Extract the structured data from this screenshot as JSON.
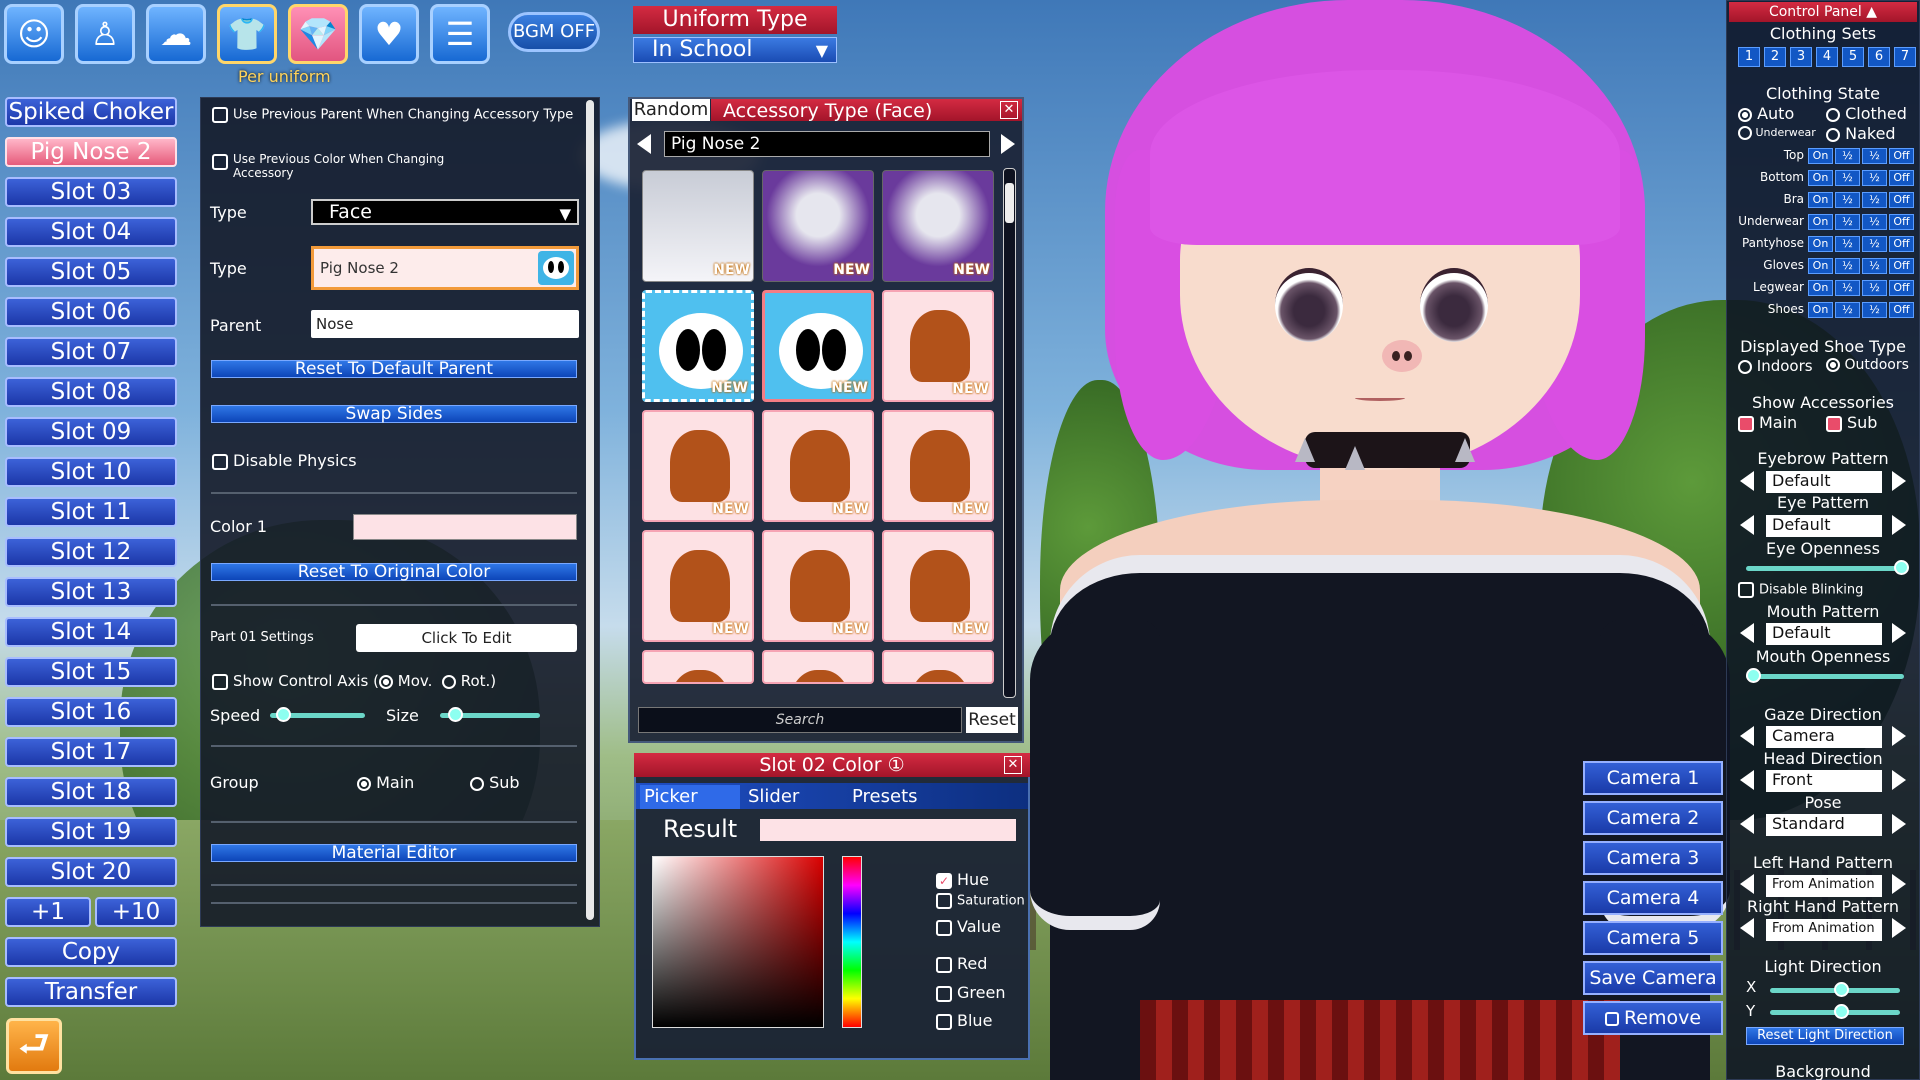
{
  "toolbar": {
    "icons": [
      "face-icon",
      "body-icon",
      "hair-icon",
      "clothes-icon",
      "accessory-icon",
      "heart-icon",
      "document-icon"
    ],
    "bgm_label": "BGM OFF",
    "per_uniform_label": "Per uniform"
  },
  "uniform": {
    "title": "Uniform Type",
    "value": "In School"
  },
  "slots": [
    {
      "label": "Spiked Choker",
      "selected": false
    },
    {
      "label": "Pig Nose 2",
      "selected": true
    },
    {
      "label": "Slot 03"
    },
    {
      "label": "Slot 04"
    },
    {
      "label": "Slot 05"
    },
    {
      "label": "Slot 06"
    },
    {
      "label": "Slot 07"
    },
    {
      "label": "Slot 08"
    },
    {
      "label": "Slot 09"
    },
    {
      "label": "Slot 10"
    },
    {
      "label": "Slot 11"
    },
    {
      "label": "Slot 12"
    },
    {
      "label": "Slot 13"
    },
    {
      "label": "Slot 14"
    },
    {
      "label": "Slot 15"
    },
    {
      "label": "Slot 16"
    },
    {
      "label": "Slot 17"
    },
    {
      "label": "Slot 18"
    },
    {
      "label": "Slot 19"
    },
    {
      "label": "Slot 20"
    }
  ],
  "slot_actions": {
    "plus1": "+1",
    "plus10": "+10",
    "copy": "Copy",
    "transfer": "Transfer"
  },
  "settings": {
    "use_prev_parent": "Use Previous Parent When Changing Accessory Type",
    "use_prev_color": "Use Previous Color When Changing Accessory",
    "type_label": "Type",
    "type_value": "Face",
    "type2_label": "Type",
    "type2_value": "Pig Nose 2",
    "parent_label": "Parent",
    "parent_value": "Nose",
    "reset_parent": "Reset To Default Parent",
    "swap_sides": "Swap Sides",
    "disable_physics": "Disable Physics",
    "color1_label": "Color 1",
    "reset_color": "Reset To Original Color",
    "part_settings": "Part 01 Settings",
    "click_to_edit": "Click To Edit",
    "show_axis": "Show Control Axis (",
    "mov": "Mov.",
    "rot": "Rot.)",
    "speed": "Speed",
    "size": "Size",
    "group": "Group",
    "main": "Main",
    "sub": "Sub",
    "material_editor": "Material Editor"
  },
  "accessory_panel": {
    "random_label": "Random",
    "title": "Accessory Type (Face)",
    "close": "✕",
    "current": "Pig Nose 2",
    "search_placeholder": "Search",
    "reset": "Reset",
    "new_badge": "NEW",
    "thumbnails": [
      "dress",
      "portrait",
      "portrait",
      "mask",
      "mask-selected",
      "hair",
      "hair",
      "hair",
      "hair",
      "hair",
      "hair",
      "hair",
      "hair",
      "hair",
      "hair"
    ]
  },
  "color_panel": {
    "title": "Slot 02 Color ①",
    "close": "✕",
    "tabs": [
      "Picker",
      "Slider",
      "Presets"
    ],
    "result_label": "Result",
    "options": [
      "Hue",
      "Saturation",
      "Value",
      "Red",
      "Green",
      "Blue"
    ],
    "checked": "Hue"
  },
  "cameras": [
    "Camera 1",
    "Camera 2",
    "Camera 3",
    "Camera 4",
    "Camera 5"
  ],
  "save_camera": "Save Camera",
  "remove": "Remove",
  "control_panel": {
    "title": "Control Panel",
    "clothing_sets": "Clothing Sets",
    "set_numbers": [
      "1",
      "2",
      "3",
      "4",
      "5",
      "6",
      "7"
    ],
    "clothing_state": "Clothing State",
    "auto": "Auto",
    "clothed": "Clothed",
    "underwear": "Underwear",
    "naked": "Naked",
    "rows": [
      "Top",
      "Bottom",
      "Bra",
      "Underwear",
      "Pantyhose",
      "Gloves",
      "Legwear",
      "Shoes"
    ],
    "state_on": "On",
    "state_half": "½",
    "state_off": "Off",
    "shoe_type": "Displayed Shoe Type",
    "indoors": "Indoors",
    "outdoors": "Outdoors",
    "show_accessories": "Show Accessories",
    "main": "Main",
    "sub": "Sub",
    "eyebrow_pattern": "Eyebrow Pattern",
    "eyebrow_value": "Default",
    "eye_pattern": "Eye Pattern",
    "eye_value": "Default",
    "eye_openness": "Eye Openness",
    "disable_blinking": "Disable Blinking",
    "mouth_pattern": "Mouth Pattern",
    "mouth_value": "Default",
    "mouth_openness": "Mouth Openness",
    "gaze_direction": "Gaze Direction",
    "gaze_value": "Camera",
    "head_direction": "Head Direction",
    "head_value": "Front",
    "pose": "Pose",
    "pose_value": "Standard",
    "left_hand": "Left Hand Pattern",
    "left_hand_value": "From Animation",
    "right_hand": "Right Hand Pattern",
    "right_hand_value": "From Animation",
    "light_direction": "Light Direction",
    "x": "X",
    "y": "Y",
    "reset_light": "Reset Light Direction",
    "background": "Background"
  },
  "colors": {
    "accent_blue": "#1d3bb0",
    "accent_pink": "#e8627e",
    "header_red": "#b71c30"
  }
}
